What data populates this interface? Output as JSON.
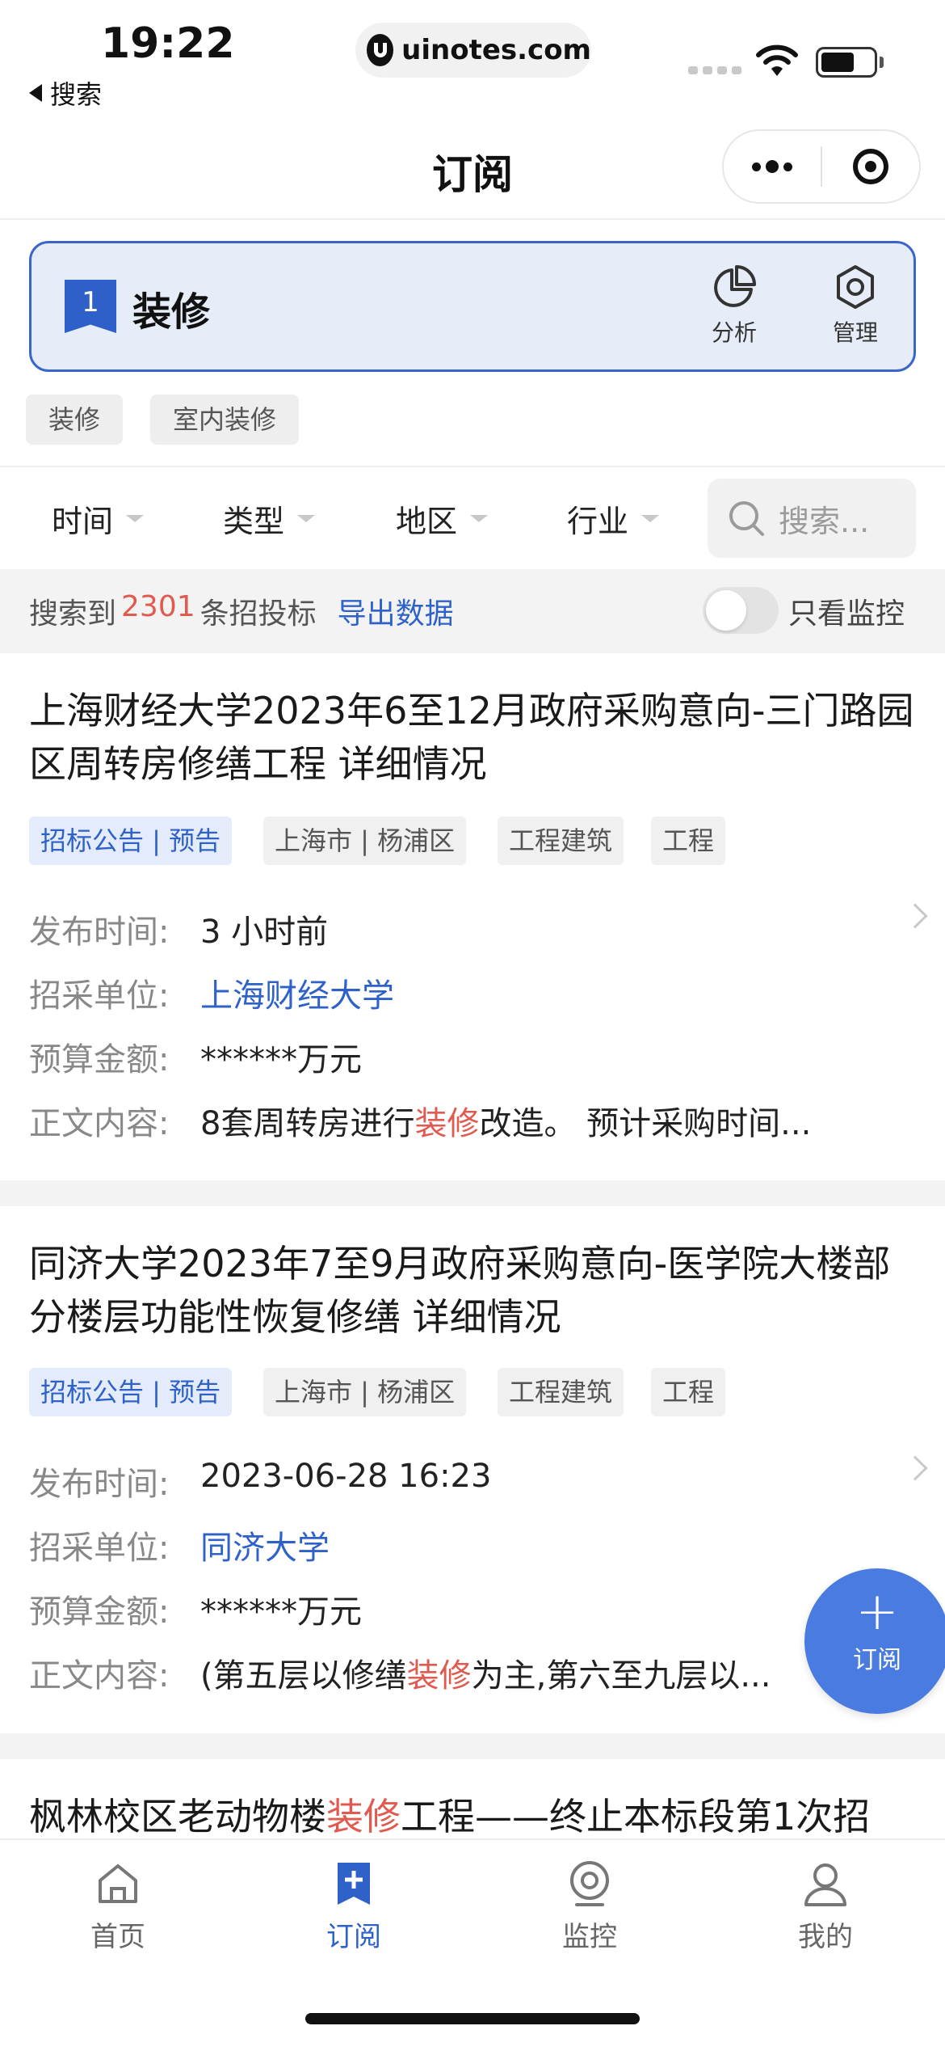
{
  "status_bar": {
    "time": "19:22",
    "back_label": "搜索",
    "url": "uinotes.com"
  },
  "nav": {
    "title": "订阅"
  },
  "subscription": {
    "index": "1",
    "name": "装修",
    "actions": {
      "analyze": "分析",
      "manage": "管理"
    },
    "keywords": [
      "装修",
      "室内装修"
    ]
  },
  "filters": {
    "time": "时间",
    "type": "类型",
    "region": "地区",
    "industry": "行业",
    "search_placeholder": "搜索..."
  },
  "results": {
    "prefix": "搜索到",
    "count": "2301",
    "suffix": "条招投标",
    "export": "导出数据",
    "monitor_only": "只看监控"
  },
  "labels": {
    "publish_time": "发布时间:",
    "purchaser": "招采单位:",
    "budget": "预算金额:",
    "content": "正文内容:"
  },
  "items": [
    {
      "title": "上海财经大学2023年6至12月政府采购意向-三门路园区周转房修缮工程 详细情况",
      "tags": [
        "招标公告 | 预告",
        "上海市 | 杨浦区",
        "工程建筑",
        "工程"
      ],
      "publish_time": "3 小时前",
      "purchaser": "上海财经大学",
      "budget": "******万元",
      "content_pre": "8套周转房进行",
      "content_hl": "装修",
      "content_post": "改造。 预计采购时间..."
    },
    {
      "title": "同济大学2023年7至9月政府采购意向-医学院大楼部分楼层功能性恢复修缮 详细情况",
      "tags": [
        "招标公告 | 预告",
        "上海市 | 杨浦区",
        "工程建筑",
        "工程"
      ],
      "publish_time": "2023-06-28 16:23",
      "purchaser": "同济大学",
      "budget": "******万元",
      "content_pre": "(第五层以修缮",
      "content_hl": "装修",
      "content_post": "为主,第六至九层以..."
    },
    {
      "title_pre": "枫林校区老动物楼",
      "title_hl": "装修",
      "title_post": "工程——终止本标段第1次招"
    }
  ],
  "fab": {
    "label": "订阅"
  },
  "tabbar": {
    "home": "首页",
    "subscribe": "订阅",
    "monitor": "监控",
    "mine": "我的"
  },
  "colors": {
    "accent": "#2f62c9",
    "highlight": "#e05a4f",
    "card_bg": "#e6edf9"
  }
}
